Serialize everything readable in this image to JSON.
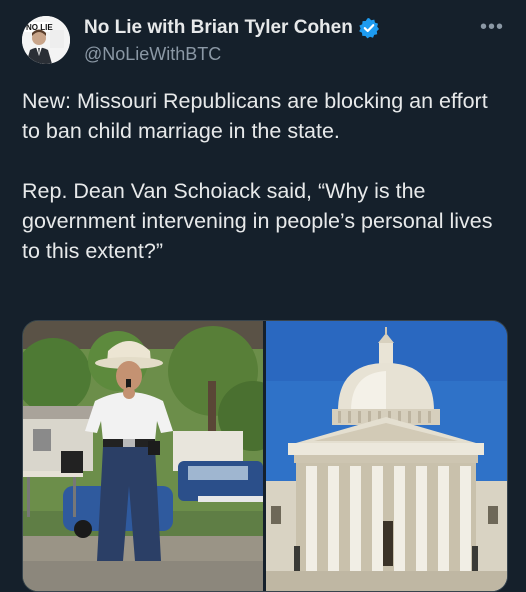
{
  "tweet": {
    "author": {
      "display_name": "No Lie with Brian Tyler Cohen",
      "handle": "@NoLieWithBTC",
      "verified": true,
      "avatar_logo_text": "NO LIE"
    },
    "text_paragraphs": [
      "New: Missouri Republicans are blocking an effort to ban child marriage in the state.",
      "Rep. Dean Van Schoiack said, “Why is the government intervening in people’s personal lives to this extent?”"
    ],
    "more_icon": "more-horizontal-icon",
    "colors": {
      "background": "#15202b",
      "text": "#e7e9ea",
      "secondary": "#8b98a5",
      "verified": "#1d9bf0"
    }
  }
}
